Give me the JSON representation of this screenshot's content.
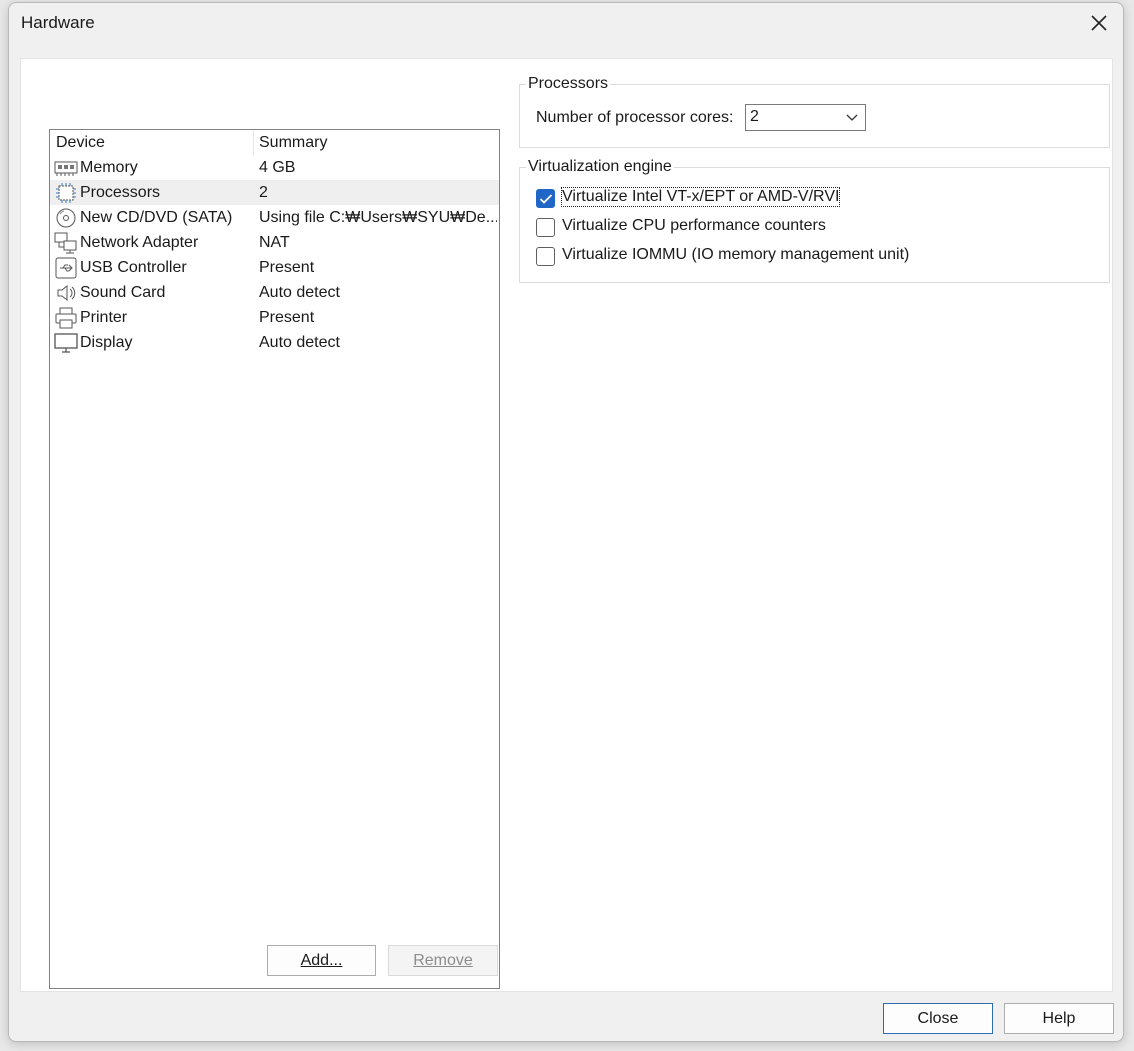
{
  "window": {
    "title": "Hardware"
  },
  "device_list": {
    "headers": {
      "device": "Device",
      "summary": "Summary"
    },
    "rows": [
      {
        "name": "Memory",
        "summary": "4 GB",
        "icon": "memory-icon"
      },
      {
        "name": "Processors",
        "summary": "2",
        "icon": "processor-icon",
        "selected": true
      },
      {
        "name": "New CD/DVD (SATA)",
        "summary": "Using file C:₩Users₩SYU₩De...",
        "icon": "cd-dvd-icon"
      },
      {
        "name": "Network Adapter",
        "summary": "NAT",
        "icon": "network-adapter-icon"
      },
      {
        "name": "USB Controller",
        "summary": "Present",
        "icon": "usb-icon"
      },
      {
        "name": "Sound Card",
        "summary": "Auto detect",
        "icon": "speaker-icon"
      },
      {
        "name": "Printer",
        "summary": "Present",
        "icon": "printer-icon"
      },
      {
        "name": "Display",
        "summary": "Auto detect",
        "icon": "monitor-icon"
      }
    ]
  },
  "buttons": {
    "add_label": "Add...",
    "remove_label": "Remove",
    "close_label": "Close",
    "help_label": "Help"
  },
  "processors_group": {
    "title": "Processors",
    "cores_label": "Number of processor cores:",
    "cores_value": "2"
  },
  "virtualization_group": {
    "title": "Virtualization engine",
    "options": [
      {
        "label": "Virtualize Intel VT-x/EPT or AMD-V/RVI",
        "checked": true
      },
      {
        "label": "Virtualize CPU performance counters",
        "checked": false
      },
      {
        "label": "Virtualize IOMMU (IO memory management unit)",
        "checked": false
      }
    ]
  },
  "colors": {
    "accent": "#1f66c6",
    "selected_row": "#efefef"
  }
}
